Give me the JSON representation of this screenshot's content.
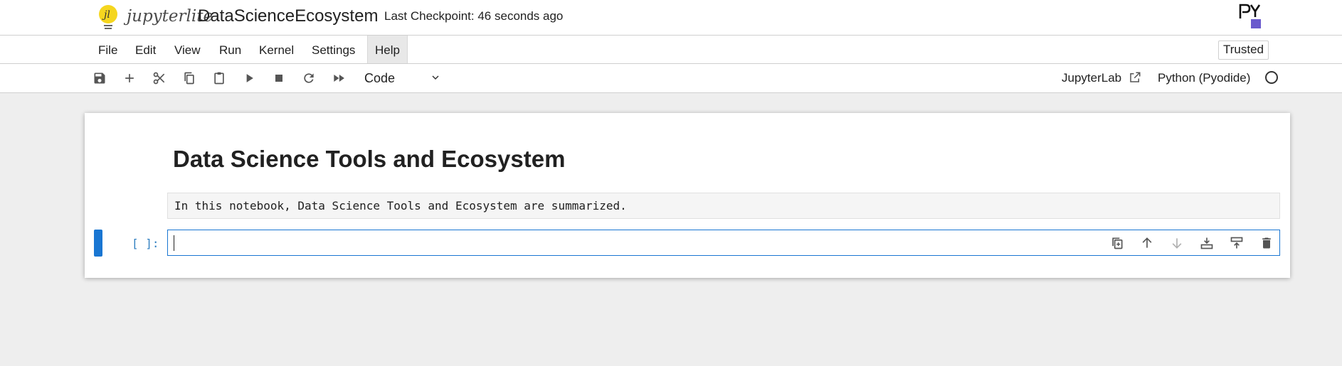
{
  "header": {
    "logo_text": "jupyterlite",
    "notebook_title": "DataScienceEcosystem",
    "checkpoint": "Last Checkpoint: 46 seconds ago"
  },
  "menu": {
    "items": [
      "File",
      "Edit",
      "View",
      "Run",
      "Kernel",
      "Settings",
      "Help"
    ],
    "active": "Help",
    "trusted_label": "Trusted"
  },
  "toolbar": {
    "icons": [
      "save-icon",
      "add-icon",
      "cut-icon",
      "copy-icon",
      "paste-icon",
      "run-icon",
      "stop-icon",
      "restart-icon",
      "fast-forward-icon"
    ],
    "cell_type": "Code",
    "jupyterlab_link": "JupyterLab",
    "kernel_name": "Python (Pyodide)"
  },
  "notebook": {
    "heading": "Data Science Tools and Ecosystem",
    "intro_text": "In this notebook, Data Science Tools and Ecosystem are summarized.",
    "prompt": "[ ]:",
    "code": ""
  },
  "cell_toolbar": {
    "icons": [
      "duplicate-icon",
      "move-up-icon",
      "move-down-icon",
      "insert-below-icon",
      "insert-above-icon",
      "delete-icon"
    ]
  },
  "colors": {
    "accent": "#1976d2",
    "prompt": "#307fc1",
    "logo_yellow": "#f5d61f",
    "pyodide_purple": "#6a5acd"
  }
}
